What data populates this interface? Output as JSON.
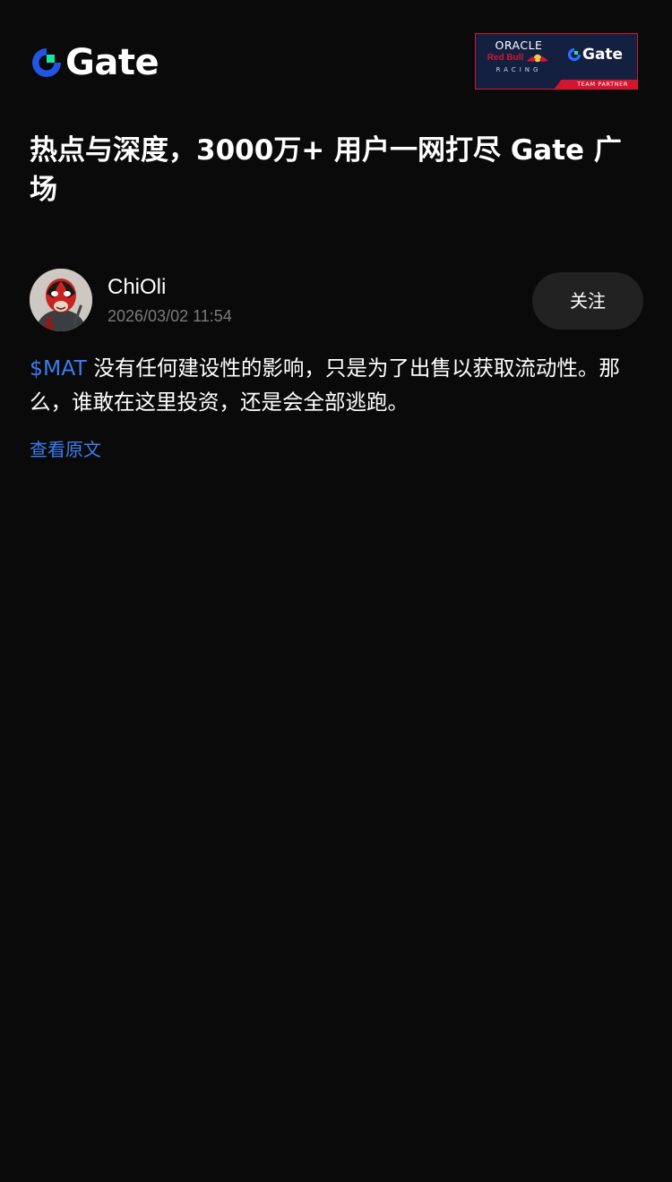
{
  "header": {
    "logo_text": "Gate",
    "partner_badge": {
      "oracle": "ORACLE",
      "redbull": "Red Bull",
      "racing": "RACING",
      "gate_text": "Gate",
      "strip_text": "TEAM PARTNER"
    }
  },
  "page": {
    "title": "热点与深度，3000万+ 用户一网打尽 Gate 广场"
  },
  "post": {
    "author": {
      "name": "ChiOli",
      "avatar_icon": "deadpool-avatar"
    },
    "timestamp": "2026/03/02 11:54",
    "follow_label": "关注",
    "ticker": "$MAT",
    "body": " 没有任何建设性的影响，只是为了出售以获取流动性。那么，谁敢在这里投资，还是会全部逃跑。",
    "view_original_label": "查看原文"
  },
  "colors": {
    "background": "#0a0a0a",
    "accent_blue": "#3d7cf0",
    "brand_green": "#17e6a1",
    "button_bg": "#222222",
    "muted_text": "#7b7b7b",
    "badge_navy": "#13203f",
    "badge_red": "#d3162f"
  }
}
